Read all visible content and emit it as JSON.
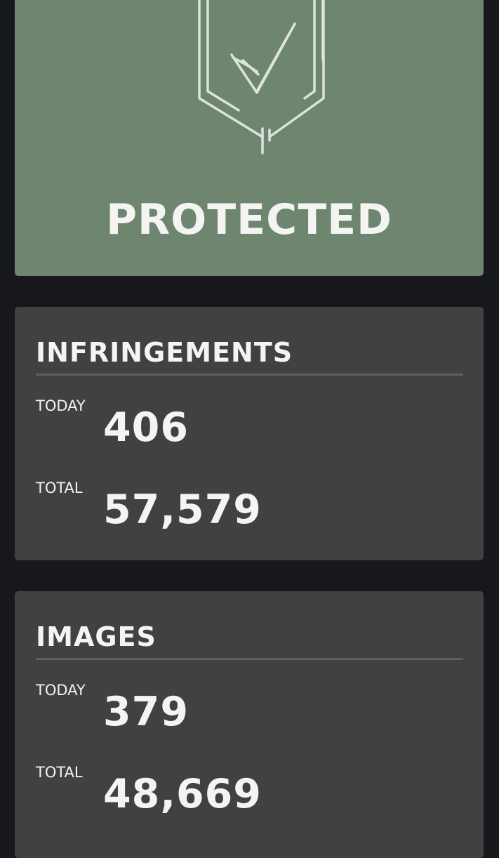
{
  "status": {
    "label": "PROTECTED",
    "icon": "shield-check-icon",
    "color": "#6e8670"
  },
  "infringements": {
    "title": "INFRINGEMENTS",
    "today_label": "TODAY",
    "today_value": "406",
    "total_label": "TOTAL",
    "total_value": "57,579"
  },
  "images": {
    "title": "IMAGES",
    "today_label": "TODAY",
    "today_value": "379",
    "total_label": "TOTAL",
    "total_value": "48,669"
  }
}
